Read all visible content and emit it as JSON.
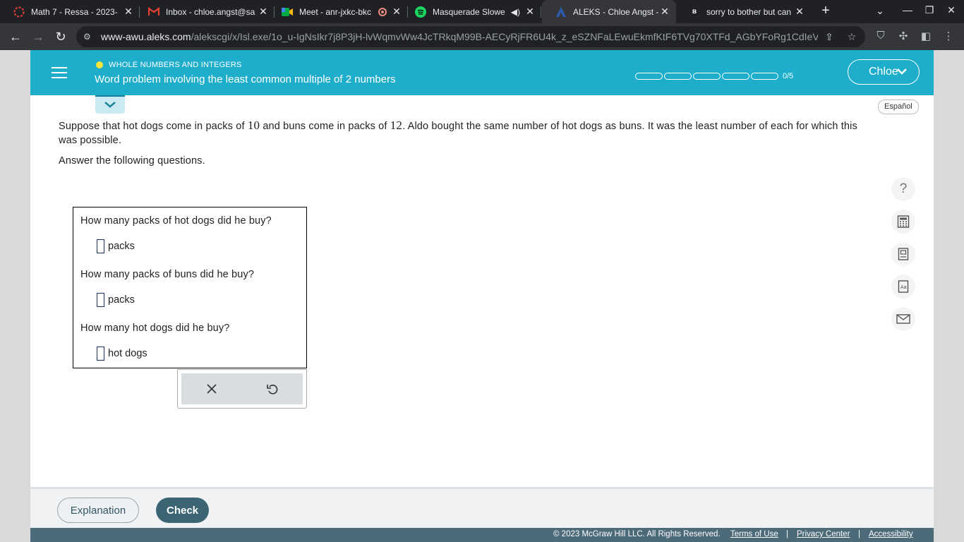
{
  "browser": {
    "tabs": [
      {
        "title": "Math 7 - Ressa - 2023-",
        "icon": "recording-icon"
      },
      {
        "title": "Inbox - chloe.angst@sa",
        "icon": "gmail-icon"
      },
      {
        "title": "Meet - anr-jxkc-bkc",
        "icon": "meet-icon"
      },
      {
        "title": "Masquerade Slowe",
        "icon": "spotify-icon"
      },
      {
        "title": "ALEKS - Chloe Angst - L",
        "icon": "aleks-icon"
      },
      {
        "title": "sorry to bother but can",
        "icon": "brainly-icon"
      }
    ],
    "url_host": "www-awu.aleks.com",
    "url_path": "/alekscgi/x/Isl.exe/1o_u-IgNsIkr7j8P3jH-lvWqmvWw4JcTRkqM99B-AECyRjFR6U4k_z_eSZNFaLEwuEkmfKtF6TVg70XTFd_AGbYFoRg1CdIeV..."
  },
  "header": {
    "topic": "WHOLE NUMBERS AND INTEGERS",
    "title": "Word problem involving the least common multiple of 2 numbers",
    "progress_count": "0/5",
    "progress_fraction": 0,
    "user": "Chloe"
  },
  "language_button": "Español",
  "problem": {
    "p1": "Suppose that hot dogs come in packs of ",
    "n1": "10",
    "p2": " and buns come in packs of ",
    "n2": "12",
    "p3": ". Aldo bought the same number of hot dogs as buns. It was the least number of each for which this was possible.",
    "instruction": "Answer the following questions."
  },
  "questions": [
    {
      "text": "How many packs of hot dogs did he buy?",
      "unit": "packs"
    },
    {
      "text": "How many packs of buns did he buy?",
      "unit": "packs"
    },
    {
      "text": "How many hot dogs did he buy?",
      "unit": "hot dogs"
    }
  ],
  "sidebar_tools": [
    "help-icon",
    "calculator-icon",
    "textbook-icon",
    "dictionary-icon",
    "message-icon"
  ],
  "sidebar_help_glyph": "?",
  "footer": {
    "explanation": "Explanation",
    "check": "Check",
    "copyright": "© 2023 McGraw Hill LLC. All Rights Reserved.",
    "terms": "Terms of Use",
    "privacy": "Privacy Center",
    "accessibility": "Accessibility",
    "separator": "|"
  }
}
